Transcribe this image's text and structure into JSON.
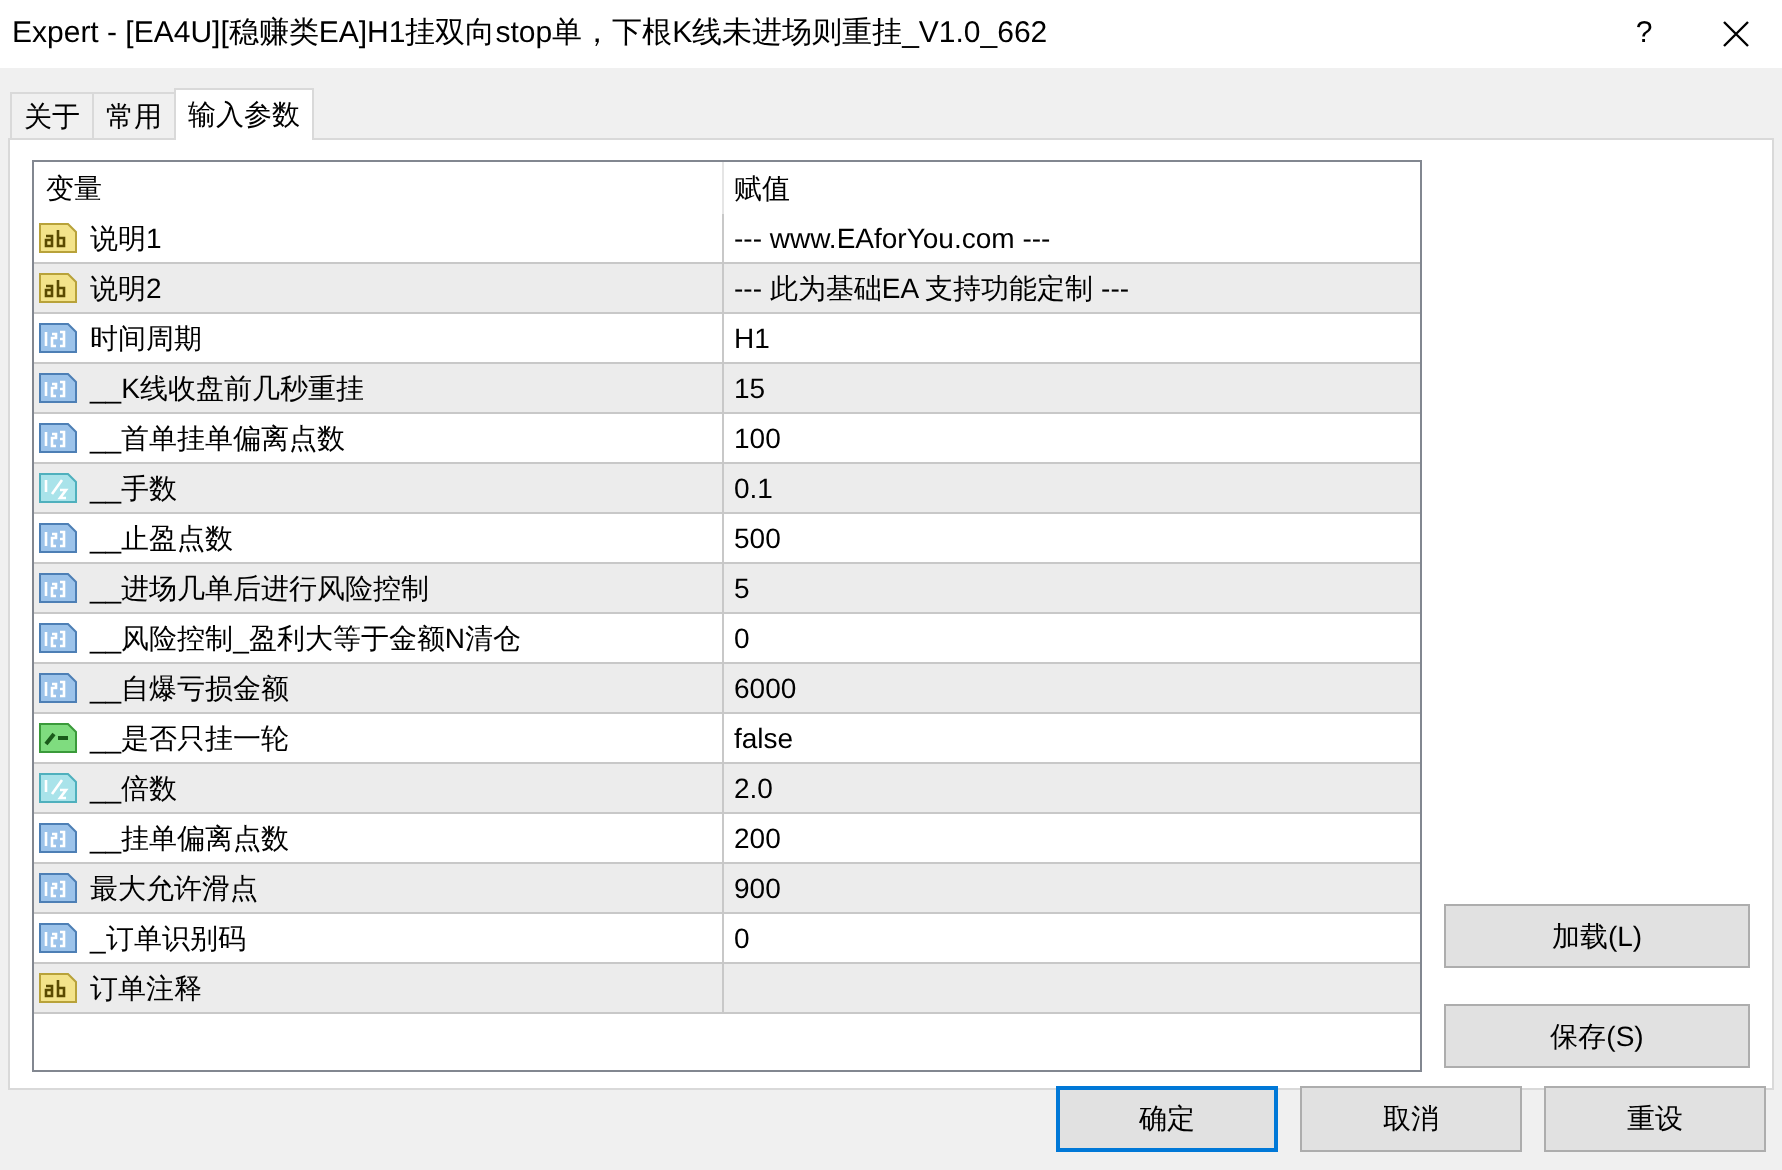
{
  "window": {
    "title": "Expert - [EA4U][稳赚类EA]H1挂双向stop单，下根K线未进场则重挂_V1.0_662",
    "help": "?"
  },
  "tabs": [
    {
      "label": "关于",
      "selected": false
    },
    {
      "label": "常用",
      "selected": false
    },
    {
      "label": "输入参数",
      "selected": true
    }
  ],
  "table": {
    "columns": [
      "变量",
      "赋值"
    ],
    "rows": [
      {
        "kind": "string",
        "name": "说明1",
        "value": "--- www.EAforYou.com ---"
      },
      {
        "kind": "string",
        "name": "说明2",
        "value": "--- 此为基础EA 支持功能定制 ---"
      },
      {
        "kind": "int",
        "name": "时间周期",
        "value": "H1"
      },
      {
        "kind": "int",
        "name": "__K线收盘前几秒重挂",
        "value": "15"
      },
      {
        "kind": "int",
        "name": "__首单挂单偏离点数",
        "value": "100"
      },
      {
        "kind": "double",
        "name": "__手数",
        "value": "0.1"
      },
      {
        "kind": "int",
        "name": "__止盈点数",
        "value": "500"
      },
      {
        "kind": "int",
        "name": "__进场几单后进行风险控制",
        "value": "5"
      },
      {
        "kind": "int",
        "name": "__风险控制_盈利大等于金额N清仓",
        "value": "0"
      },
      {
        "kind": "int",
        "name": "__自爆亏损金额",
        "value": "6000"
      },
      {
        "kind": "bool",
        "name": "__是否只挂一轮",
        "value": "false"
      },
      {
        "kind": "double",
        "name": "__倍数",
        "value": "2.0"
      },
      {
        "kind": "int",
        "name": "__挂单偏离点数",
        "value": "200"
      },
      {
        "kind": "int",
        "name": "最大允许滑点",
        "value": "900"
      },
      {
        "kind": "int",
        "name": "_订单识别码",
        "value": "0"
      },
      {
        "kind": "string",
        "name": "订单注释"
      }
    ]
  },
  "side_buttons": [
    "加载(L)",
    "保存(S)"
  ],
  "buttons": [
    {
      "label": "确定",
      "default": true
    },
    {
      "label": "取消",
      "default": false
    },
    {
      "label": "重设",
      "default": false
    }
  ]
}
